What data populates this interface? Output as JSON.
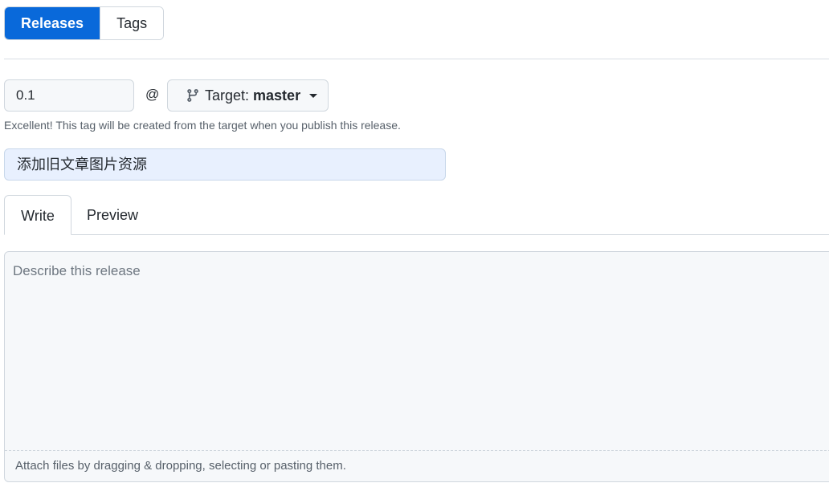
{
  "nav": {
    "items": [
      {
        "label": "Releases",
        "selected": true
      },
      {
        "label": "Tags",
        "selected": false
      }
    ]
  },
  "tag": {
    "value": "0.1",
    "at": "@",
    "target_label": "Target:",
    "target_branch": "master",
    "hint": "Excellent! This tag will be created from the target when you publish this release."
  },
  "release": {
    "title_value": "添加旧文章图片资源"
  },
  "tabs": [
    {
      "label": "Write",
      "active": true
    },
    {
      "label": "Preview",
      "active": false
    }
  ],
  "editor": {
    "placeholder": "Describe this release",
    "footer": "Attach files by dragging & dropping, selecting or pasting them."
  },
  "colors": {
    "accent": "#0969da",
    "border": "#d0d7de",
    "muted_text": "#57606a",
    "title_bg": "#e8f0fe"
  },
  "icons": {
    "branch": "git-branch-icon",
    "caret": "caret-down-icon"
  }
}
